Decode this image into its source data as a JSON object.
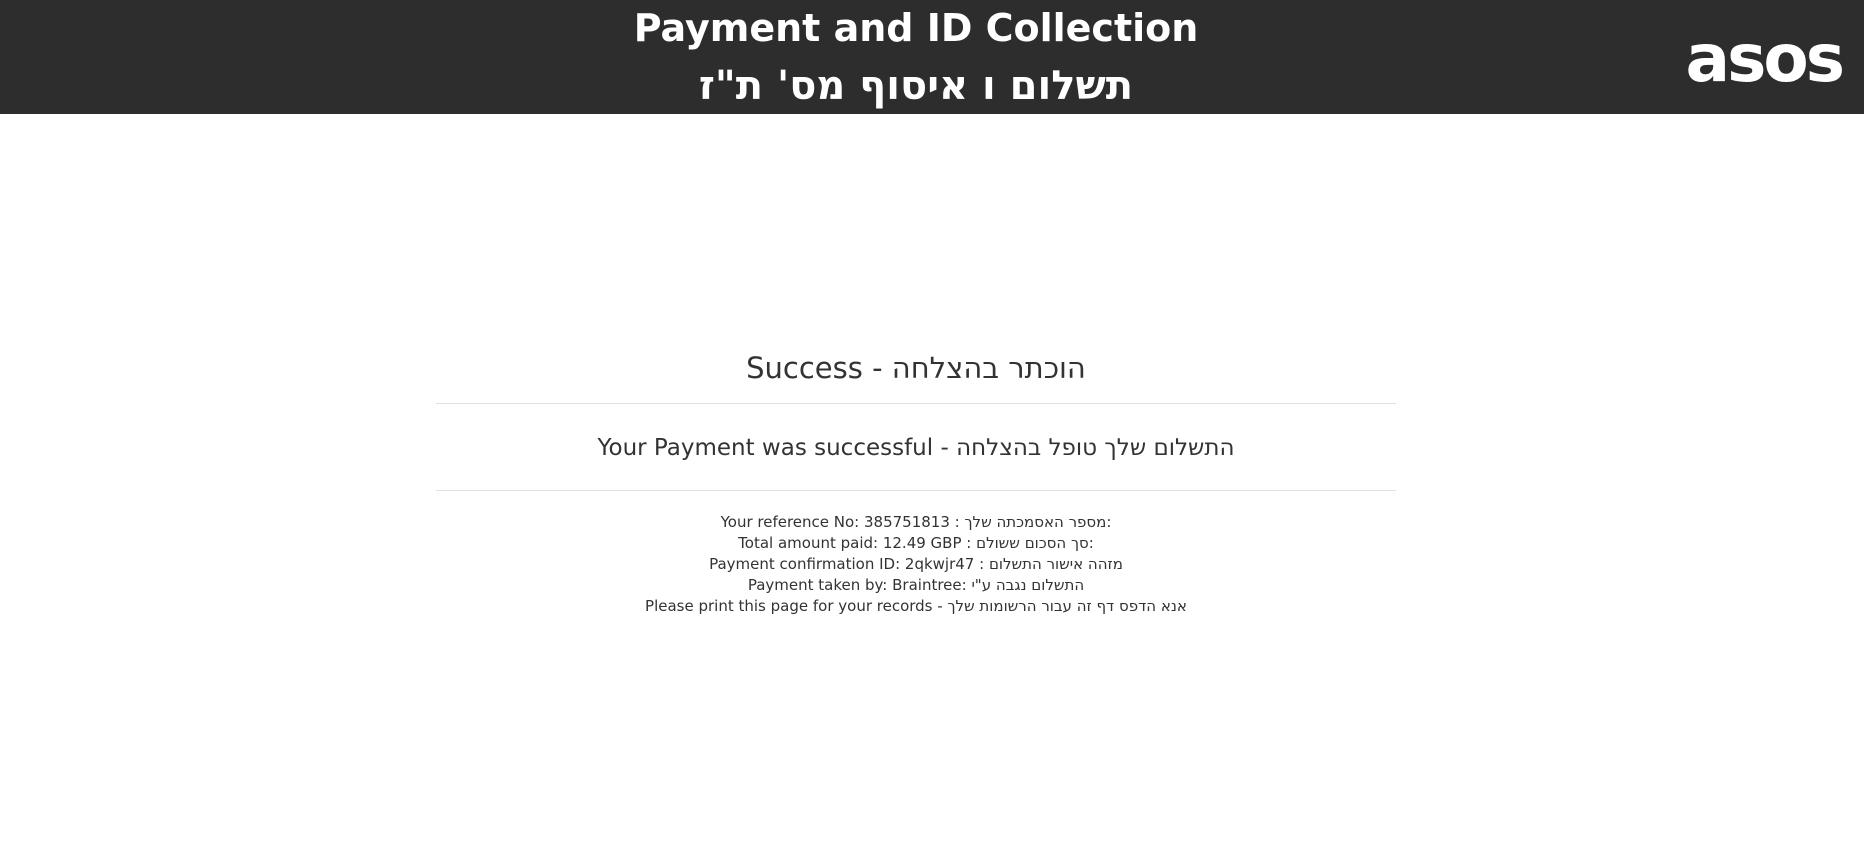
{
  "header": {
    "title_en": "Payment and ID Collection",
    "title_he": "תשלום ו איסוף מס' ת\"ז",
    "logo_text": "asos",
    "background_color": "#2d2d2d"
  },
  "main": {
    "heading": "Success - הוכתר בהצלחה",
    "message": "Your Payment was successful - התשלום שלך טופל בהצלחה",
    "details": [
      "Your reference No: 385751813 : מספר האסמכתה שלך:",
      "Total amount paid: 12.49 GBP : סך הסכום ששולם:",
      "Payment confirmation ID: 2qkwjr47 : מזהה אישור התשלום",
      "Payment taken by: Braintree: התשלום נגבה ע\"י",
      "Please print this page for your records - אנא הדפס דף זה עבור הרשומות שלך"
    ]
  }
}
